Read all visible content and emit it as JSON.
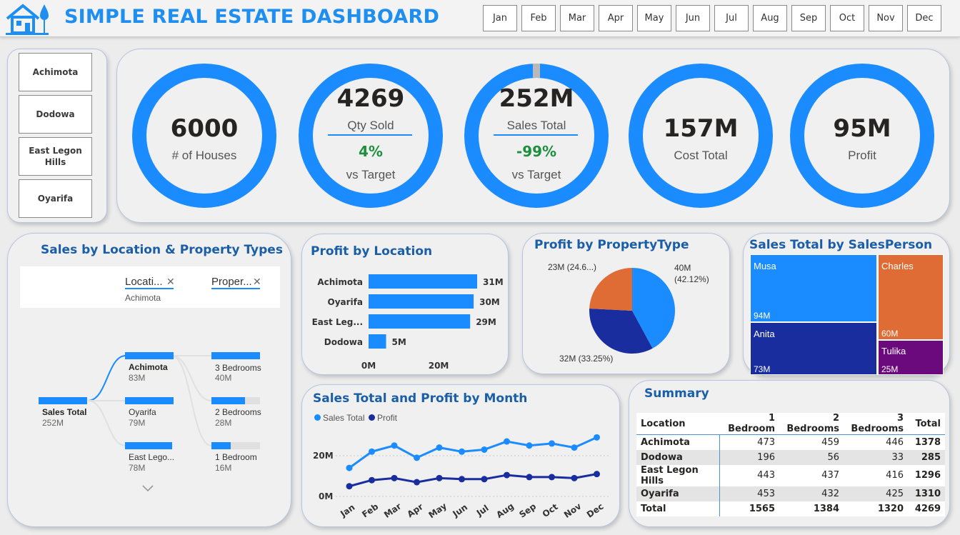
{
  "header": {
    "title": "SIMPLE REAL ESTATE DASHBOARD",
    "months": [
      "Jan",
      "Feb",
      "Mar",
      "Apr",
      "May",
      "Jun",
      "Jul",
      "Aug",
      "Sep",
      "Oct",
      "Nov",
      "Dec"
    ]
  },
  "location_slicer": [
    "Achimota",
    "Dodowa",
    "East Legon Hills",
    "Oyarifa"
  ],
  "kpis": {
    "houses": {
      "value": "6000",
      "label": "# of Houses"
    },
    "qty": {
      "value": "4269",
      "label": "Qty Sold",
      "pct": "4%",
      "sub": "vs Target"
    },
    "sales": {
      "value": "252M",
      "label": "Sales Total",
      "pct": "-99%",
      "sub": "vs Target"
    },
    "cost": {
      "value": "157M",
      "label": "Cost Total"
    },
    "profit": {
      "value": "95M",
      "label": "Profit"
    }
  },
  "colors": {
    "accent": "#1a8cff",
    "navy": "#1a2d9e",
    "orange": "#e06c35",
    "purple": "#6b0a7d",
    "green": "#1e8f3e"
  },
  "decomp": {
    "title": "Sales by Location & Property Types",
    "col1": "Locati...",
    "col1_sub": "Achimota",
    "col2": "Proper...",
    "root": {
      "name": "Sales Total",
      "value": "252M"
    },
    "locations": [
      {
        "name": "Achimota",
        "value": "83M"
      },
      {
        "name": "Oyarifa",
        "value": "79M"
      },
      {
        "name": "East Lego...",
        "value": "78M"
      }
    ],
    "types": [
      {
        "name": "3 Bedrooms",
        "value": "40M"
      },
      {
        "name": "2 Bedrooms",
        "value": "28M"
      },
      {
        "name": "1 Bedroom",
        "value": "16M"
      }
    ]
  },
  "profit_location": {
    "title": "Profit by Location",
    "bars": [
      {
        "label": "Achimota",
        "value": "31M"
      },
      {
        "label": "Oyarifa",
        "value": "30M"
      },
      {
        "label": "East Leg...",
        "value": "29M"
      },
      {
        "label": "Dodowa",
        "value": "5M"
      }
    ],
    "ticks": [
      "0M",
      "20M"
    ]
  },
  "profit_type": {
    "title": "Profit by PropertyType",
    "labels": [
      "40M",
      "(42.12%)",
      "32M (33.25%)",
      "23M (24.6...)"
    ]
  },
  "salesperson": {
    "title": "Sales Total by SalesPerson",
    "cells": [
      {
        "name": "Musa",
        "value": "94M"
      },
      {
        "name": "Charles",
        "value": "60M"
      },
      {
        "name": "Anita",
        "value": "73M"
      },
      {
        "name": "Tulika",
        "value": "25M"
      }
    ]
  },
  "month_chart": {
    "title": "Sales Total and Profit by Month",
    "legend": [
      "Sales Total",
      "Profit"
    ],
    "yticks": [
      "20M",
      "0M"
    ],
    "xticks": [
      "Jan",
      "Feb",
      "Mar",
      "Apr",
      "May",
      "Jun",
      "Jul",
      "Aug",
      "Sep",
      "Oct",
      "Nov",
      "Dec"
    ]
  },
  "summary": {
    "title": "Summary",
    "headers": [
      "Location",
      "1 Bedroom",
      "2 Bedrooms",
      "3 Bedrooms",
      "Total"
    ],
    "rows": [
      [
        "Achimota",
        "473",
        "459",
        "446",
        "1378"
      ],
      [
        "Dodowa",
        "196",
        "56",
        "33",
        "285"
      ],
      [
        "East Legon Hills",
        "443",
        "437",
        "416",
        "1296"
      ],
      [
        "Oyarifa",
        "453",
        "432",
        "425",
        "1310"
      ]
    ],
    "total": [
      "Total",
      "1565",
      "1384",
      "1320",
      "4269"
    ]
  },
  "chart_data": [
    {
      "type": "bar",
      "title": "Profit by Location",
      "categories": [
        "Achimota",
        "Oyarifa",
        "East Leg...",
        "Dodowa"
      ],
      "values": [
        31,
        30,
        29,
        5
      ],
      "unit": "M",
      "xlim": [
        0,
        31
      ]
    },
    {
      "type": "pie",
      "title": "Profit by PropertyType",
      "categories": [
        "",
        "",
        ""
      ],
      "values": [
        40,
        32,
        23
      ],
      "percents": [
        42.12,
        33.25,
        24.6
      ]
    },
    {
      "type": "line",
      "title": "Sales Total and Profit by Month",
      "categories": [
        "Jan",
        "Feb",
        "Mar",
        "Apr",
        "May",
        "Jun",
        "Jul",
        "Aug",
        "Sep",
        "Oct",
        "Nov",
        "Dec"
      ],
      "series": [
        {
          "name": "Sales Total",
          "values": [
            14,
            22,
            25,
            19,
            24,
            22,
            23,
            27,
            25,
            26,
            24,
            29
          ]
        },
        {
          "name": "Profit",
          "values": [
            5,
            8,
            9,
            7,
            9,
            8.5,
            8.5,
            10.5,
            9.5,
            9.5,
            9,
            11
          ]
        }
      ],
      "ylim": [
        0,
        30
      ]
    }
  ]
}
